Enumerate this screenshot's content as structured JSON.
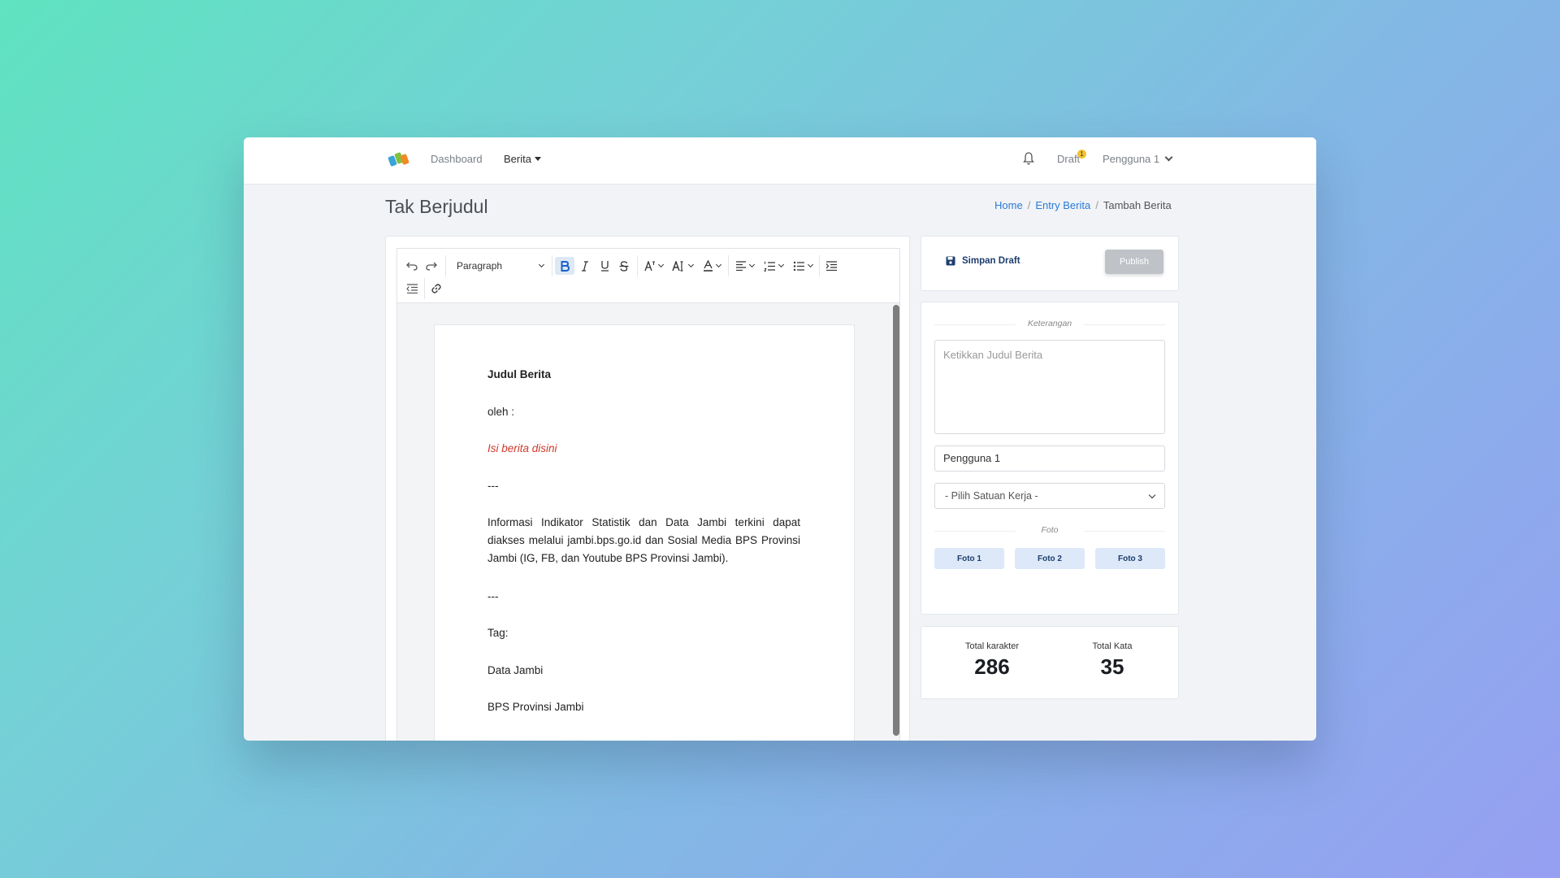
{
  "nav": {
    "dashboard": "Dashboard",
    "berita": "Berita",
    "draft": "Draft",
    "draft_count": "1",
    "user": "Pengguna 1"
  },
  "page": {
    "title": "Tak Berjudul",
    "breadcrumb": [
      "Home",
      "Entry Berita",
      "Tambah Berita"
    ]
  },
  "toolbar": {
    "block_format": "Paragraph"
  },
  "document": {
    "title": "Judul Berita",
    "byline": "oleh :",
    "placeholder": "Isi berita disini",
    "separator": "---",
    "info": "Informasi Indikator Statistik dan Data Jambi terkini dapat diakses melalui jambi.bps.go.id dan Sosial Media BPS Provinsi Jambi (IG, FB, dan Youtube BPS Provinsi Jambi).",
    "tag_label": "Tag:",
    "tag_1": "Data Jambi",
    "tag_2": "BPS Provinsi Jambi"
  },
  "actions": {
    "save_draft": "Simpan Draft",
    "publish": "Publish"
  },
  "form": {
    "keterangan_label": "Keterangan",
    "title_placeholder": "Ketikkan Judul Berita",
    "author": "Pengguna 1",
    "satuan_kerja": "- Pilih Satuan Kerja -",
    "foto_label": "Foto",
    "foto_buttons": [
      "Foto 1",
      "Foto 2",
      "Foto 3"
    ]
  },
  "stats": {
    "chars_label": "Total karakter",
    "chars_value": "286",
    "words_label": "Total Kata",
    "words_value": "35"
  },
  "colors": {
    "link": "#2a7bd6",
    "accent_dark": "#1c3d6e",
    "placeholder_red": "#d0392b",
    "badge": "#f2c230"
  }
}
